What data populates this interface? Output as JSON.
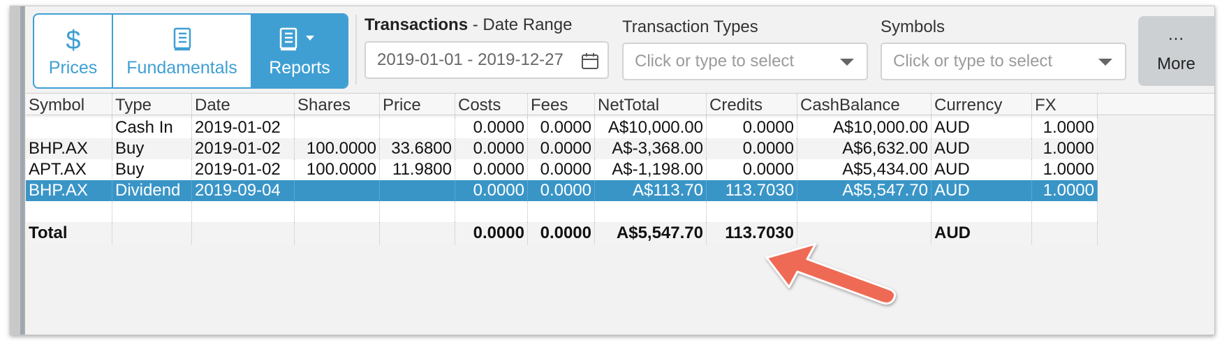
{
  "toolbar": {
    "buttons": [
      {
        "label": "Prices",
        "icon": "dollar-icon"
      },
      {
        "label": "Fundamentals",
        "icon": "book-icon"
      },
      {
        "label": "Reports",
        "icon": "book-icon"
      }
    ],
    "more_dots": "...",
    "more_label": "More"
  },
  "filters": {
    "transactions_bold": "Transactions",
    "date_range_label": " - Date Range",
    "date_range_value": "2019-01-01 - 2019-12-27",
    "types_label": "Transaction Types",
    "types_placeholder": "Click or type to select",
    "symbols_label": "Symbols",
    "symbols_placeholder": "Click or type to select"
  },
  "table": {
    "columns": [
      "Symbol",
      "Type",
      "Date",
      "Shares",
      "Price",
      "Costs",
      "Fees",
      "NetTotal",
      "Credits",
      "CashBalance",
      "Currency",
      "FX"
    ],
    "rows": [
      [
        "",
        "Cash In",
        "2019-01-02",
        "",
        "",
        "0.0000",
        "0.0000",
        "A$10,000.00",
        "0.0000",
        "A$10,000.00",
        "AUD",
        "1.0000"
      ],
      [
        "BHP.AX",
        "Buy",
        "2019-01-02",
        "100.0000",
        "33.6800",
        "0.0000",
        "0.0000",
        "A$-3,368.00",
        "0.0000",
        "A$6,632.00",
        "AUD",
        "1.0000"
      ],
      [
        "APT.AX",
        "Buy",
        "2019-01-02",
        "100.0000",
        "11.9800",
        "0.0000",
        "0.0000",
        "A$-1,198.00",
        "0.0000",
        "A$5,434.00",
        "AUD",
        "1.0000"
      ],
      [
        "BHP.AX",
        "Dividend",
        "2019-09-04",
        "",
        "",
        "0.0000",
        "0.0000",
        "A$113.70",
        "113.7030",
        "A$5,547.70",
        "AUD",
        "1.0000"
      ],
      [
        "",
        "",
        "",
        "",
        "",
        "",
        "",
        "",
        "",
        "",
        "",
        ""
      ]
    ],
    "total": [
      "Total",
      "",
      "",
      "",
      "",
      "0.0000",
      "0.0000",
      "A$5,547.70",
      "113.7030",
      "",
      "AUD",
      ""
    ]
  },
  "colors": {
    "accent": "#3f9fd3",
    "selected_row": "#3a95c7",
    "annotation_arrow": "#ef6a55"
  }
}
